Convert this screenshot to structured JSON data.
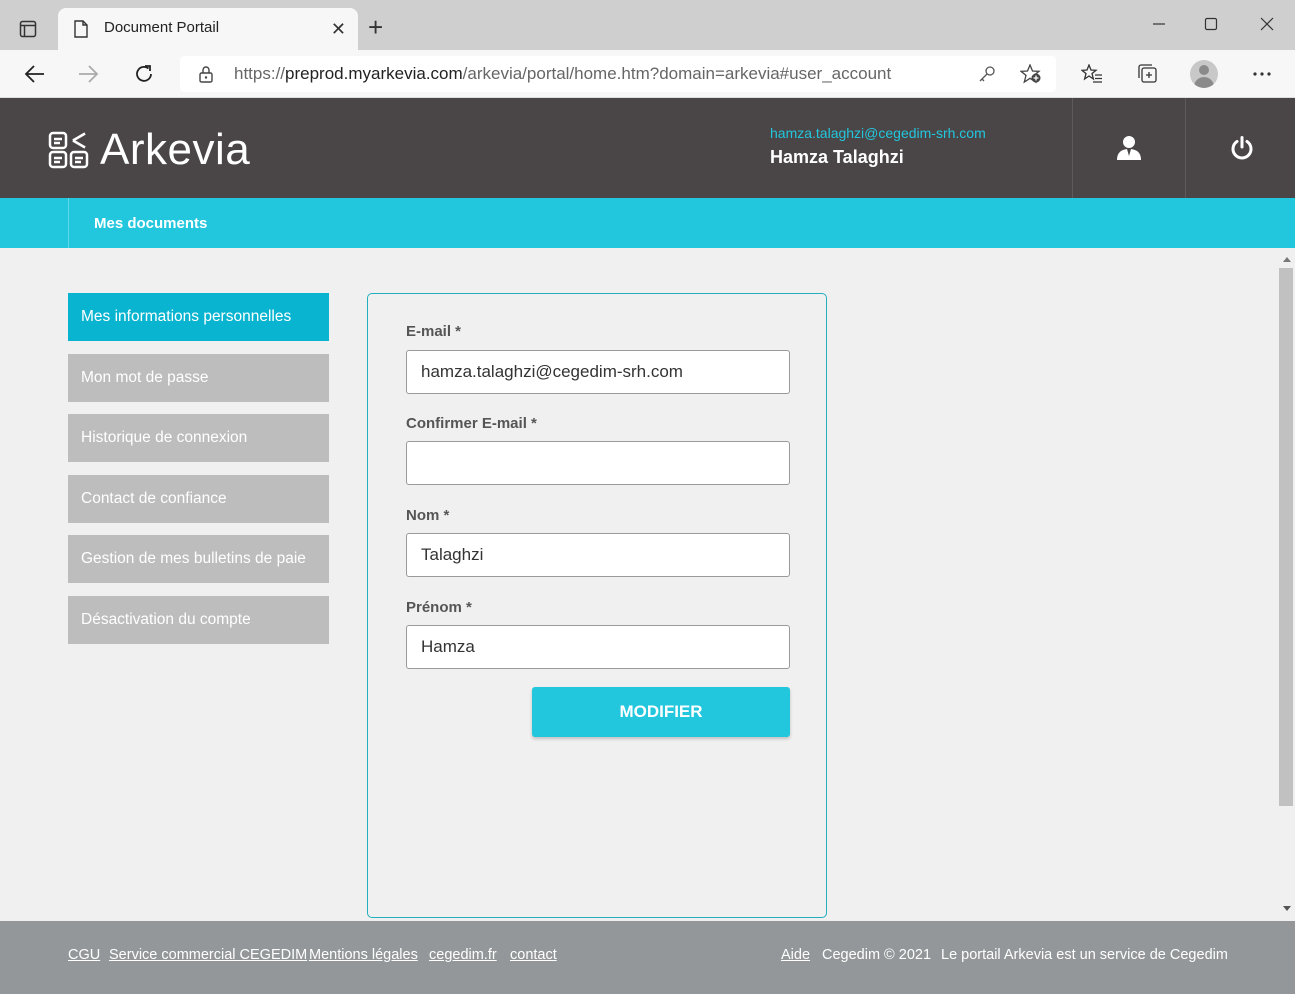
{
  "browser": {
    "tab_title": "Document Portail",
    "url_prefix": "https://",
    "url_host": "preprod.myarkevia.com",
    "url_path": "/arkevia/portal/home.htm?domain=arkevia#user_account"
  },
  "header": {
    "logo_text": "Arkevia",
    "user_email": "hamza.talaghzi@cegedim-srh.com",
    "user_name": "Hamza Talaghzi"
  },
  "nav": {
    "items": [
      {
        "label": "Mes documents"
      }
    ]
  },
  "sidebar": {
    "items": [
      {
        "label": "Mes informations personnelles",
        "active": true
      },
      {
        "label": "Mon mot de passe"
      },
      {
        "label": "Historique de connexion"
      },
      {
        "label": "Contact de confiance"
      },
      {
        "label": "Gestion de mes bulletins de paie"
      },
      {
        "label": "Désactivation du compte"
      }
    ]
  },
  "form": {
    "email_label": "E-mail *",
    "email_value": "hamza.talaghzi@cegedim-srh.com",
    "confirm_label": "Confirmer E-mail *",
    "confirm_value": "",
    "nom_label": "Nom *",
    "nom_value": "Talaghzi",
    "prenom_label": "Prénom *",
    "prenom_value": "Hamza",
    "submit_label": "MODIFIER"
  },
  "footer": {
    "links_left": [
      "CGU",
      "Service commercial CEGEDIM",
      "Mentions légales",
      "cegedim.fr",
      "contact"
    ],
    "aide": "Aide",
    "copyright": "Cegedim © 2021",
    "service_text": "Le portail Arkevia est un service de Cegedim"
  },
  "colors": {
    "header_bg": "#4a4546",
    "accent": "#22c7de",
    "active_sidebar": "#08b4d0",
    "sidebar_bg": "#bdbdbd",
    "footer_bg": "#939799"
  }
}
